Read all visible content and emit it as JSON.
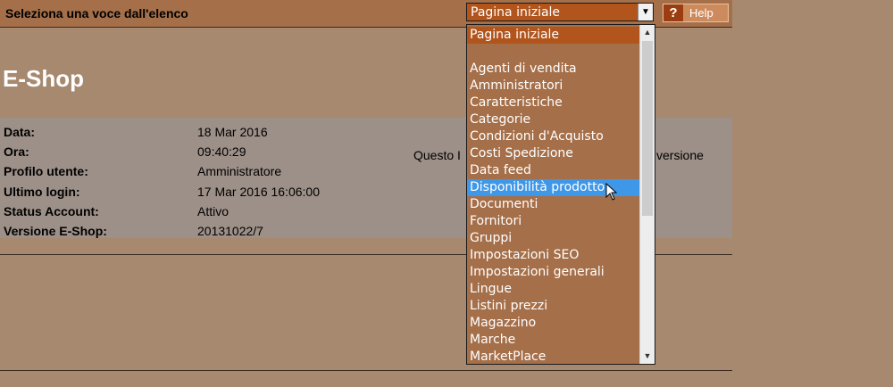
{
  "header": {
    "title": "Seleziona una voce dall'elenco",
    "select_value": "Pagina iniziale",
    "help_label": "Help",
    "help_icon_glyph": "?"
  },
  "page_title": "E-Shop",
  "info": {
    "rows": [
      {
        "label": "Data:",
        "value": "18 Mar 2016"
      },
      {
        "label": "Ora:",
        "value": "09:40:29"
      },
      {
        "label": "Profilo utente:",
        "value": "Amministratore"
      },
      {
        "label": "Ultimo login:",
        "value": "17 Mar 2016 16:06:00"
      },
      {
        "label": "Status Account:",
        "value": "Attivo"
      },
      {
        "label": "Versione E-Shop:",
        "value": "20131022/7"
      }
    ],
    "notice_left": "Questo I",
    "notice_right": "versione"
  },
  "dropdown": {
    "items": [
      "Pagina iniziale",
      "",
      "Agenti di vendita",
      "Amministratori",
      "Caratteristiche",
      "Categorie",
      "Condizioni d'Acquisto",
      "Costi Spedizione",
      "Data feed",
      "Disponibilità prodotto",
      "Documenti",
      "Fornitori",
      "Gruppi",
      "Impostazioni SEO",
      "Impostazioni generali",
      "Lingue",
      "Listini prezzi",
      "Magazzino",
      "Marche",
      "MarketPlace"
    ],
    "selected_index": 0,
    "hover_index": 9
  },
  "colors": {
    "background": "#a7896f",
    "header_bg": "#a56f49",
    "selected_bg": "#b1551d",
    "hover_bg": "#3f97e8",
    "info_bg": "#9d9088"
  }
}
